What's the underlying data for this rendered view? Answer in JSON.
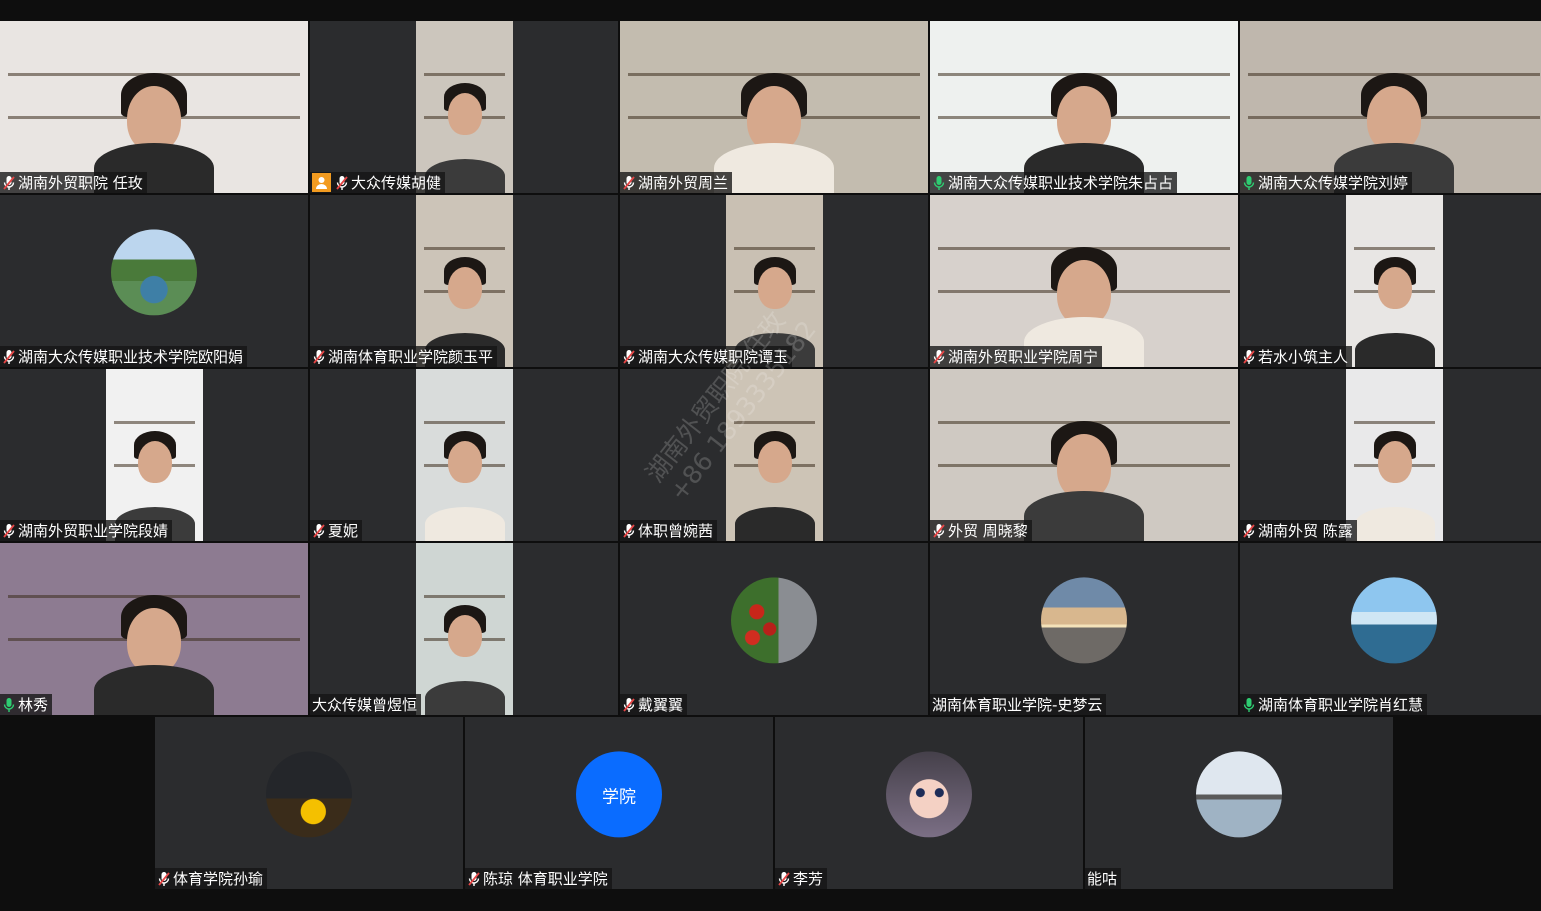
{
  "participants": [
    {
      "name": "湖南外贸职院 任玫",
      "mic": "muted",
      "video": "full",
      "bg": "#e9e5e2"
    },
    {
      "name": "大众传媒胡健",
      "mic": "muted",
      "host": true,
      "video": "portrait",
      "bg": "#ccc6bd"
    },
    {
      "name": "湖南外贸周兰",
      "mic": "muted",
      "video": "full",
      "bg": "#c3bcaf"
    },
    {
      "name": "湖南大众传媒职业技术学院朱占占",
      "mic": "active",
      "video": "full",
      "bg": "#eef1ef"
    },
    {
      "name": "湖南大众传媒学院刘婷",
      "mic": "active",
      "video": "full",
      "bg": "#bfb7ad",
      "active": true
    },
    {
      "name": "湖南大众传媒职业技术学院欧阳娟",
      "mic": "muted",
      "avatar": "landscape"
    },
    {
      "name": "湖南体育职业学院颜玉平",
      "mic": "muted",
      "video": "portrait",
      "bg": "#ccc4b8"
    },
    {
      "name": "湖南大众传媒职院谭玉",
      "mic": "muted",
      "video": "portrait",
      "bg": "#c9c0b3"
    },
    {
      "name": "湖南外贸职业学院周宁",
      "mic": "muted",
      "video": "full",
      "bg": "#d7d1cc"
    },
    {
      "name": "若水小筑主人",
      "mic": "muted",
      "video": "portrait",
      "bg": "#e8e6e4"
    },
    {
      "name": "湖南外贸职业学院段婧",
      "mic": "muted",
      "video": "portrait",
      "bg": "#f1f1f1"
    },
    {
      "name": "夏妮",
      "mic": "muted",
      "video": "portrait",
      "bg": "#d9dcdb"
    },
    {
      "name": "体职曾婉茜",
      "mic": "muted",
      "video": "portrait",
      "bg": "#cdc4b6"
    },
    {
      "name": "外贸 周晓黎",
      "mic": "muted",
      "video": "full",
      "bg": "#cfc9c2"
    },
    {
      "name": "湖南外贸 陈露",
      "mic": "muted",
      "video": "portrait",
      "bg": "#e9e9ea"
    },
    {
      "name": "林秀",
      "mic": "active",
      "video": "full",
      "bg": "#8d7b91"
    },
    {
      "name": "大众传媒曾煜恒",
      "mic": "none",
      "video": "portrait",
      "bg": "#cfd6d3"
    },
    {
      "name": "戴翼翼",
      "mic": "muted",
      "avatar": "cherries"
    },
    {
      "name": "湖南体育职业学院-史梦云",
      "mic": "none",
      "avatar": "sunset"
    },
    {
      "name": "湖南体育职业学院肖红慧",
      "mic": "active",
      "avatar": "lake"
    },
    {
      "name": "体育学院孙瑜",
      "mic": "muted",
      "avatar": "basketball"
    },
    {
      "name": "陈琼  体育职业学院",
      "mic": "muted",
      "avatar": "text",
      "avatar_text": "学院",
      "avatar_color": "#0a6cff"
    },
    {
      "name": "李芳",
      "mic": "muted",
      "avatar": "cartoon"
    },
    {
      "name": "能咕",
      "mic": "none",
      "avatar": "bridge"
    }
  ],
  "watermark": {
    "line1": "湖南外贸职院 任玫",
    "line2": "+86 1893335182"
  },
  "colors": {
    "tile_bg": "#2b2c2e",
    "muted_mic": "#e54545",
    "active_mic": "#2ecc71",
    "host_badge": "#f29b20"
  }
}
